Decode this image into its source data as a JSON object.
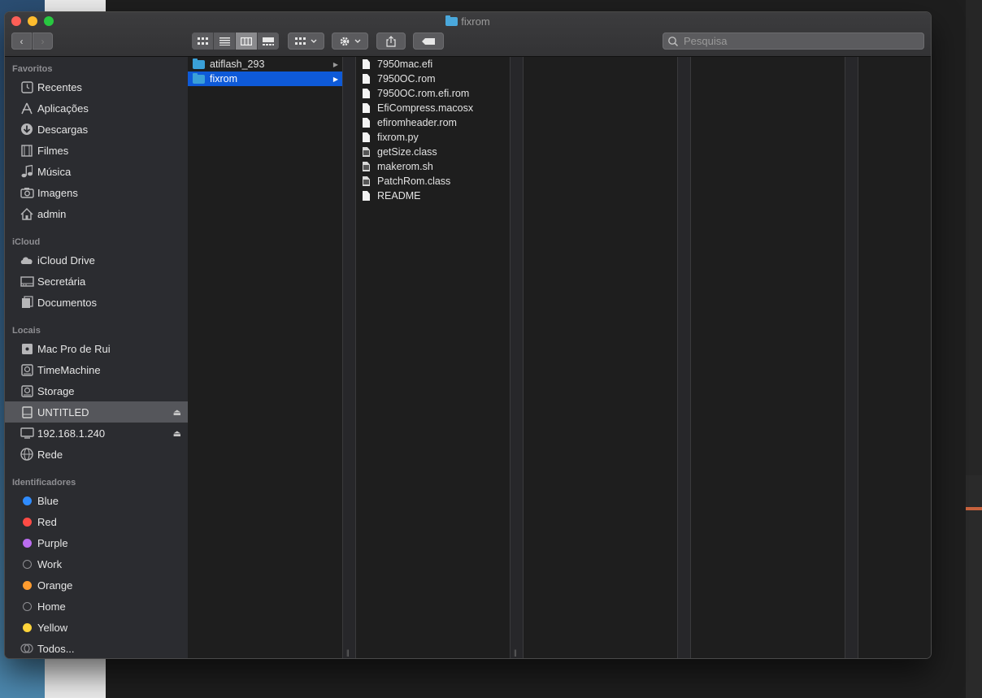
{
  "window": {
    "title": "fixrom"
  },
  "toolbar": {
    "back_glyph": "‹",
    "forward_glyph": "›",
    "view_modes": [
      "icon-view",
      "list-view",
      "column-view",
      "gallery-view"
    ],
    "active_view": "column-view",
    "search_placeholder": "Pesquisa"
  },
  "sidebar": {
    "favoritos_label": "Favoritos",
    "favoritos": [
      {
        "label": "Recentes",
        "icon": "clock-icon"
      },
      {
        "label": "Aplicações",
        "icon": "apps-icon"
      },
      {
        "label": "Descargas",
        "icon": "download-icon"
      },
      {
        "label": "Filmes",
        "icon": "film-icon"
      },
      {
        "label": "Música",
        "icon": "music-icon"
      },
      {
        "label": "Imagens",
        "icon": "camera-icon"
      },
      {
        "label": "admin",
        "icon": "home-icon"
      }
    ],
    "icloud_label": "iCloud",
    "icloud": [
      {
        "label": "iCloud Drive",
        "icon": "cloud-icon"
      },
      {
        "label": "Secretária",
        "icon": "desktop-icon"
      },
      {
        "label": "Documentos",
        "icon": "document-icon"
      }
    ],
    "locais_label": "Locais",
    "locais": [
      {
        "label": "Mac Pro de Rui",
        "icon": "computer-icon"
      },
      {
        "label": "TimeMachine",
        "icon": "disk-icon"
      },
      {
        "label": "Storage",
        "icon": "disk-icon"
      },
      {
        "label": "UNTITLED",
        "icon": "drive-icon",
        "selected": true
      },
      {
        "label": "192.168.1.240",
        "icon": "display-icon"
      },
      {
        "label": "Rede",
        "icon": "globe-icon"
      }
    ],
    "eject_glyph": "⏏",
    "tags_label": "Identificadores",
    "tags": [
      {
        "label": "Blue",
        "color": "#2f8cff"
      },
      {
        "label": "Red",
        "color": "#ff4b45"
      },
      {
        "label": "Purple",
        "color": "#bb6df0"
      },
      {
        "label": "Work",
        "color": "hollow"
      },
      {
        "label": "Orange",
        "color": "#ff9c2f"
      },
      {
        "label": "Home",
        "color": "hollow"
      },
      {
        "label": "Yellow",
        "color": "#ffd43a"
      },
      {
        "label": "Todos...",
        "color": "all"
      }
    ]
  },
  "columns": {
    "col1": [
      {
        "name": "atiflash_293",
        "type": "folder"
      },
      {
        "name": "fixrom",
        "type": "folder",
        "selected": true
      }
    ],
    "col2": [
      {
        "name": "7950mac.efi",
        "type": "file"
      },
      {
        "name": "7950OC.rom",
        "type": "file"
      },
      {
        "name": "7950OC.rom.efi.rom",
        "type": "file"
      },
      {
        "name": "EfiCompress.macosx",
        "type": "file"
      },
      {
        "name": "efiromheader.rom",
        "type": "file"
      },
      {
        "name": "fixrom.py",
        "type": "file"
      },
      {
        "name": "getSize.class",
        "type": "exec"
      },
      {
        "name": "makerom.sh",
        "type": "exec"
      },
      {
        "name": "PatchRom.class",
        "type": "exec"
      },
      {
        "name": "README",
        "type": "file"
      }
    ]
  }
}
